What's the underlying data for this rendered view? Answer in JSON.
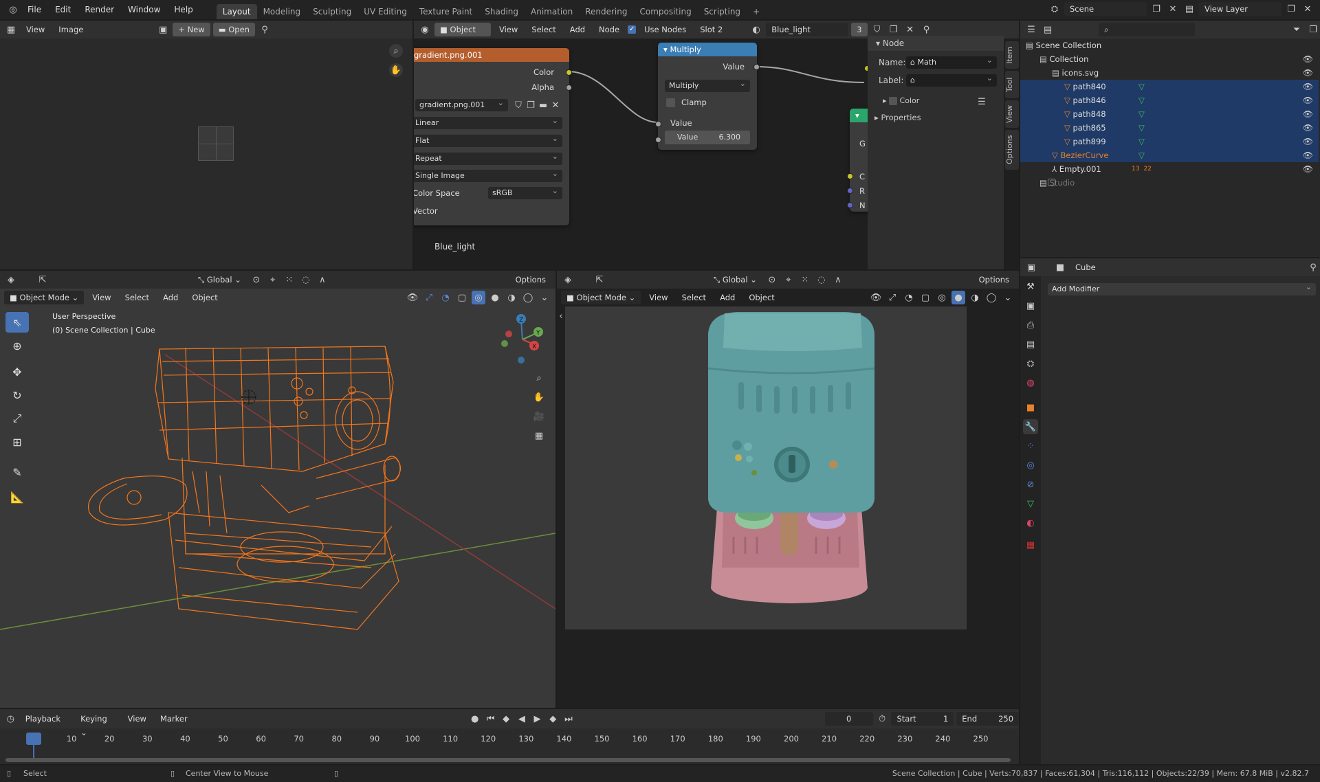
{
  "topbar": {
    "menus": [
      "File",
      "Edit",
      "Render",
      "Window",
      "Help"
    ],
    "workspaces": [
      "Layout",
      "Modeling",
      "Sculpting",
      "UV Editing",
      "Texture Paint",
      "Shading",
      "Animation",
      "Rendering",
      "Compositing",
      "Scripting"
    ],
    "active_workspace": "Layout",
    "add_tab": "+",
    "scene": "Scene",
    "view_layer": "View Layer"
  },
  "image_editor": {
    "menus": [
      "View",
      "Image"
    ],
    "new_label": "New",
    "open_label": "Open"
  },
  "node_editor": {
    "object_label": "Object",
    "menus": [
      "View",
      "Select",
      "Add",
      "Node"
    ],
    "use_nodes": "Use Nodes",
    "slot": "Slot 2",
    "material": "Blue_light",
    "users": "3",
    "material_label": "Blue_light",
    "image_node": {
      "title": "gradient.png.001",
      "out_color": "Color",
      "out_alpha": "Alpha",
      "image_name": "gradient.png.001",
      "interp": "Linear",
      "proj": "Flat",
      "ext": "Repeat",
      "source": "Single Image",
      "colorspace_label": "Color Space",
      "colorspace": "sRGB",
      "in_vector": "Vector"
    },
    "math_node": {
      "title": "Multiply",
      "out_value": "Value",
      "operation": "Multiply",
      "clamp": "Clamp",
      "in_value": "Value",
      "value_label": "Value",
      "value": "6.300"
    },
    "partial_node": {
      "row1": "G",
      "row2": "C",
      "row3": "R",
      "row4": "N"
    },
    "sidebar": {
      "section": "Node",
      "name_label": "Name:",
      "name_value": "Math",
      "label_label": "Label:",
      "label_value": "",
      "color": "Color",
      "properties": "Properties",
      "tabs": [
        "Item",
        "Tool",
        "View",
        "Options"
      ]
    }
  },
  "outliner": {
    "root": "Scene Collection",
    "rows": [
      {
        "label": "Collection",
        "selected": false,
        "indent": 1
      },
      {
        "label": "icons.svg",
        "selected": false,
        "indent": 2
      },
      {
        "label": "path840",
        "selected": true,
        "indent": 3
      },
      {
        "label": "path846",
        "selected": true,
        "indent": 3
      },
      {
        "label": "path848",
        "selected": true,
        "indent": 3
      },
      {
        "label": "path865",
        "selected": true,
        "indent": 3
      },
      {
        "label": "path899",
        "selected": true,
        "indent": 3
      },
      {
        "label": "BezierCurve",
        "selected": true,
        "indent": 2
      },
      {
        "label": "Empty.001",
        "selected": false,
        "indent": 2
      },
      {
        "label": "Studio",
        "selected": false,
        "indent": 1
      }
    ],
    "empty_badges": [
      "13",
      "22"
    ]
  },
  "viewport_left": {
    "orientation": "Global",
    "options": "Options",
    "mode": "Object Mode",
    "menus": [
      "View",
      "Select",
      "Add",
      "Object"
    ],
    "overlay_line1": "User Perspective",
    "overlay_line2": "(0) Scene Collection | Cube"
  },
  "viewport_right": {
    "orientation": "Global",
    "options": "Options",
    "mode": "Object Mode",
    "menus": [
      "View",
      "Select",
      "Add",
      "Object"
    ]
  },
  "properties": {
    "object": "Cube",
    "add_modifier": "Add Modifier"
  },
  "timeline": {
    "menus": [
      "Playback",
      "Keying",
      "View",
      "Marker"
    ],
    "current_frame": "0",
    "start_label": "Start",
    "start": "1",
    "end_label": "End",
    "end": "250",
    "ticks": [
      "0",
      "10",
      "20",
      "30",
      "40",
      "50",
      "60",
      "70",
      "80",
      "90",
      "100",
      "110",
      "120",
      "130",
      "140",
      "150",
      "160",
      "170",
      "180",
      "190",
      "200",
      "210",
      "220",
      "230",
      "240",
      "250"
    ]
  },
  "statusbar": {
    "select": "Select",
    "center_view": "Center View to Mouse",
    "stats": "Scene Collection | Cube | Verts:70,837 | Faces:61,304 | Tris:116,112 | Objects:22/39 | Mem: 67.8 MiB | v2.82.7"
  },
  "colors": {
    "accent": "#4772b3",
    "selection": "#1f3a66",
    "wire": "#ff7a1a",
    "machine_body": "#5f9ea0",
    "machine_base": "#c88c96"
  }
}
